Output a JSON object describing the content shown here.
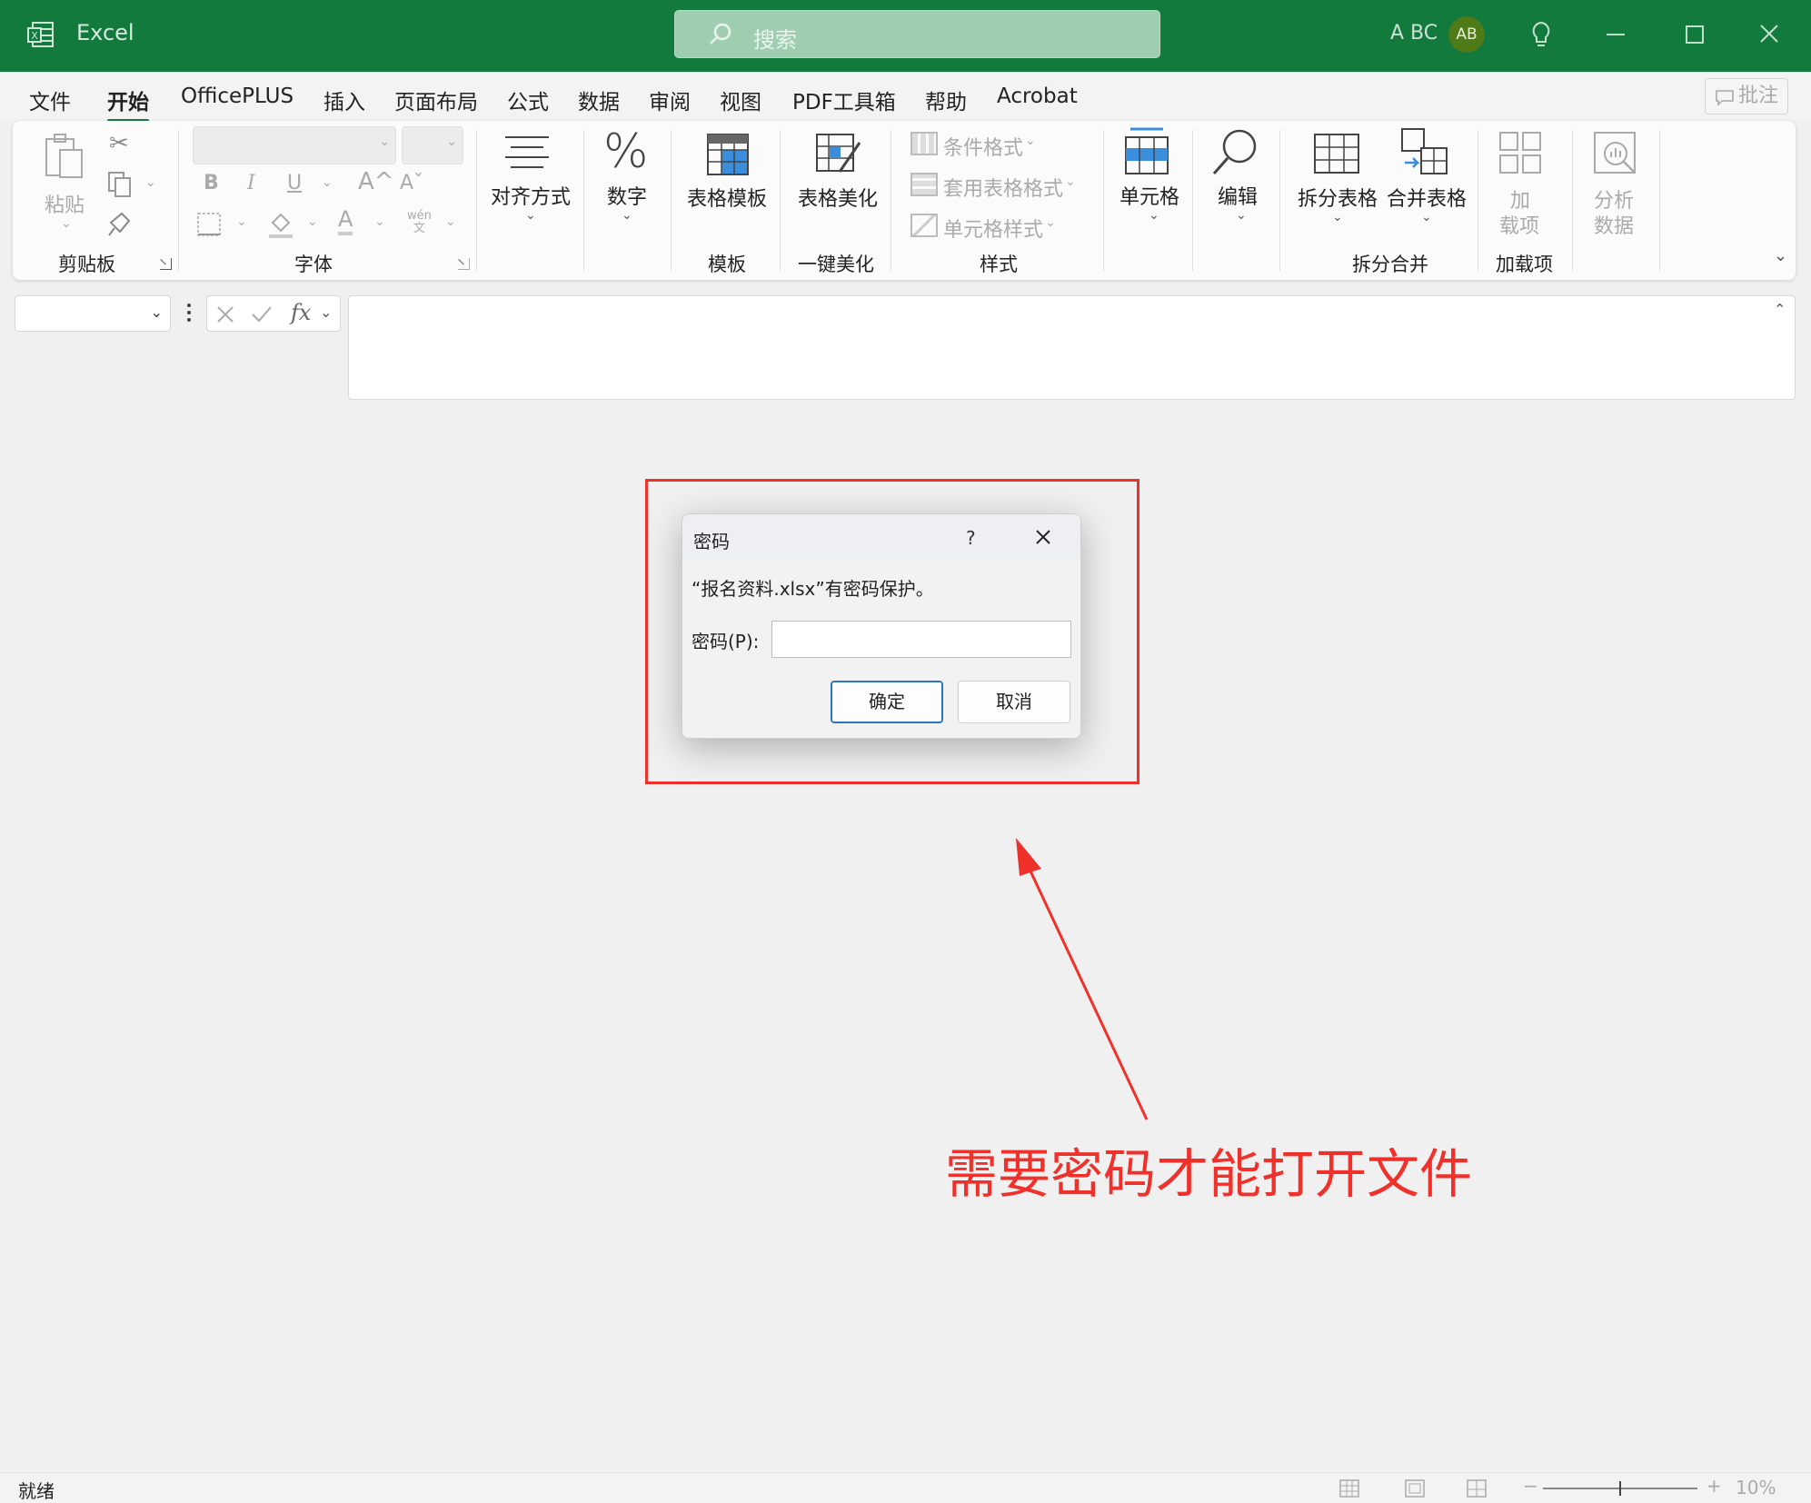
{
  "app": {
    "name": "Excel",
    "search_placeholder": "搜索",
    "user_name": "A BC",
    "avatar_initials": "AB"
  },
  "menu": {
    "tabs": [
      "文件",
      "开始",
      "OfficePLUS",
      "插入",
      "页面布局",
      "公式",
      "数据",
      "审阅",
      "视图",
      "PDF工具箱",
      "帮助",
      "Acrobat"
    ],
    "active": "开始",
    "comment_label": "批注"
  },
  "ribbon": {
    "clipboard": {
      "paste": "粘贴",
      "group": "剪贴板"
    },
    "font": {
      "group": "字体",
      "bold": "B",
      "italic": "I",
      "underline": "U",
      "grow": "A^",
      "shrink": "Aˇ",
      "font_color": "A",
      "phonetic": "wén"
    },
    "alignment": {
      "label": "对齐方式"
    },
    "number": {
      "label": "数字"
    },
    "template": {
      "label": "表格模板",
      "group": "模板"
    },
    "beautify": {
      "label": "表格美化",
      "group": "一键美化"
    },
    "styles": {
      "conditional": "条件格式",
      "table_format": "套用表格格式",
      "cell_style": "单元格样式",
      "group": "样式"
    },
    "cells": {
      "label": "单元格"
    },
    "editing": {
      "label": "编辑"
    },
    "split_merge": {
      "split": "拆分表格",
      "merge": "合并表格",
      "group": "拆分合并"
    },
    "addins": {
      "label_line1": "加",
      "label_line2": "载项",
      "group": "加载项"
    },
    "analyze": {
      "label_line1": "分析",
      "label_line2": "数据"
    }
  },
  "dialog": {
    "title": "密码",
    "help": "?",
    "message": "“报名资料.xlsx”有密码保护。",
    "password_label": "密码(P):",
    "ok": "确定",
    "cancel": "取消"
  },
  "annotation": "需要密码才能打开文件",
  "status": {
    "text": "就绪",
    "zoom": "10%"
  },
  "colors": {
    "excel_green": "#137a3e",
    "highlight_red": "#f0302a"
  }
}
